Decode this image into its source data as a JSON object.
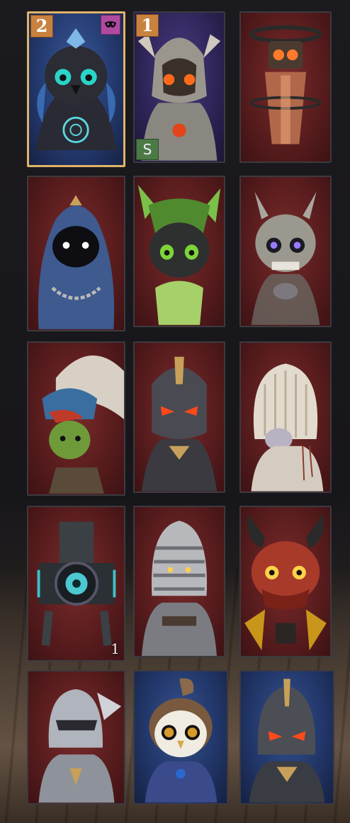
{
  "inventory": {
    "cards": [
      {
        "name": "raven-sorcerer",
        "order_badge": "2",
        "has_mask_badge": true,
        "selected": true
      },
      {
        "name": "bone-demon",
        "order_badge": "1",
        "grade_badge": "S"
      },
      {
        "name": "copper-totem"
      },
      {
        "name": "hooded-wraith"
      },
      {
        "name": "forest-dragon"
      },
      {
        "name": "skull-knight"
      },
      {
        "name": "feathered-goblin"
      },
      {
        "name": "dark-knight"
      },
      {
        "name": "shell-helm"
      },
      {
        "name": "eye-construct",
        "count": "1"
      },
      {
        "name": "cage-helm-knight"
      },
      {
        "name": "red-dragon-mask"
      },
      {
        "name": "winged-knight"
      },
      {
        "name": "white-owl"
      },
      {
        "name": "gold-trim-knight"
      }
    ]
  },
  "colors": {
    "card_bg": "#5a1d1e",
    "card_border": "#3c3a40",
    "selected_border": "#e0b36a",
    "order_badge": "#c9823e",
    "grade_badge": "#4c7a45",
    "mask_badge": "#b04aa0"
  }
}
